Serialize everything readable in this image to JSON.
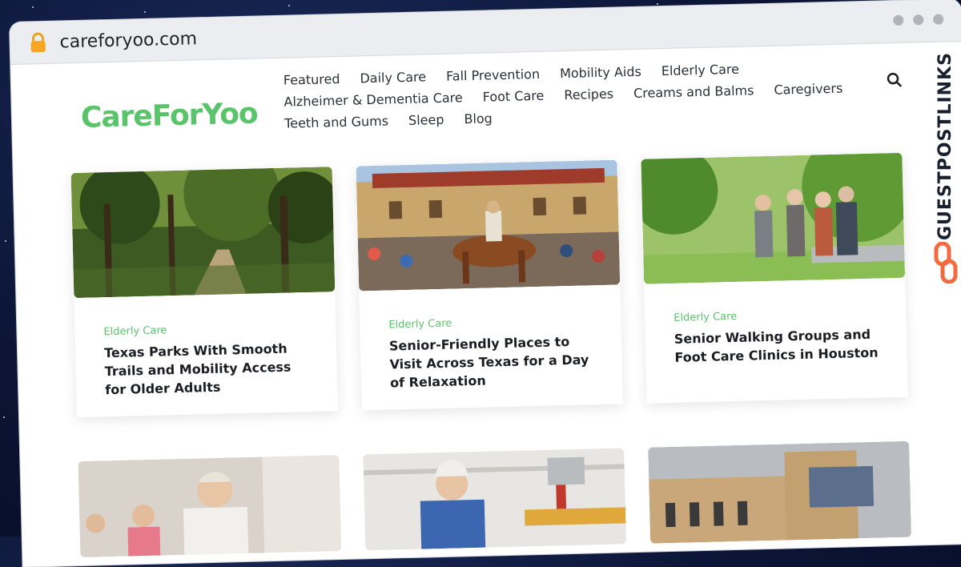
{
  "browser": {
    "url": "careforyoo.com"
  },
  "site": {
    "logo": "CareForYoo",
    "nav": {
      "row1": [
        "Featured",
        "Daily Care",
        "Fall Prevention",
        "Mobility Aids",
        "Elderly Care"
      ],
      "row2": [
        "Alzheimer & Dementia Care",
        "Foot Care",
        "Recipes",
        "Creams and Balms",
        "Caregivers"
      ],
      "row3": [
        "Teeth and Gums",
        "Sleep",
        "Blog"
      ]
    }
  },
  "cards": [
    {
      "category": "Elderly Care",
      "title": "Texas Parks With Smooth Trails and Mobility Access for Older Adults",
      "image": "forest-trail"
    },
    {
      "category": "Elderly Care",
      "title": "Senior-Friendly Places to Visit Across Texas for a Day of Relaxation",
      "image": "livestock-exchange-horse"
    },
    {
      "category": "Elderly Care",
      "title": "Senior Walking Groups and Foot Care Clinics in Houston",
      "image": "seniors-walking-park"
    }
  ],
  "cards_row2": [
    {
      "image": "senior-yoga"
    },
    {
      "image": "senior-workshop"
    },
    {
      "image": "historic-building"
    }
  ],
  "watermark": "GUESTPOSTLINKS",
  "colors": {
    "brand_green": "#59c46a",
    "watermark_orange": "#f26a3d"
  }
}
